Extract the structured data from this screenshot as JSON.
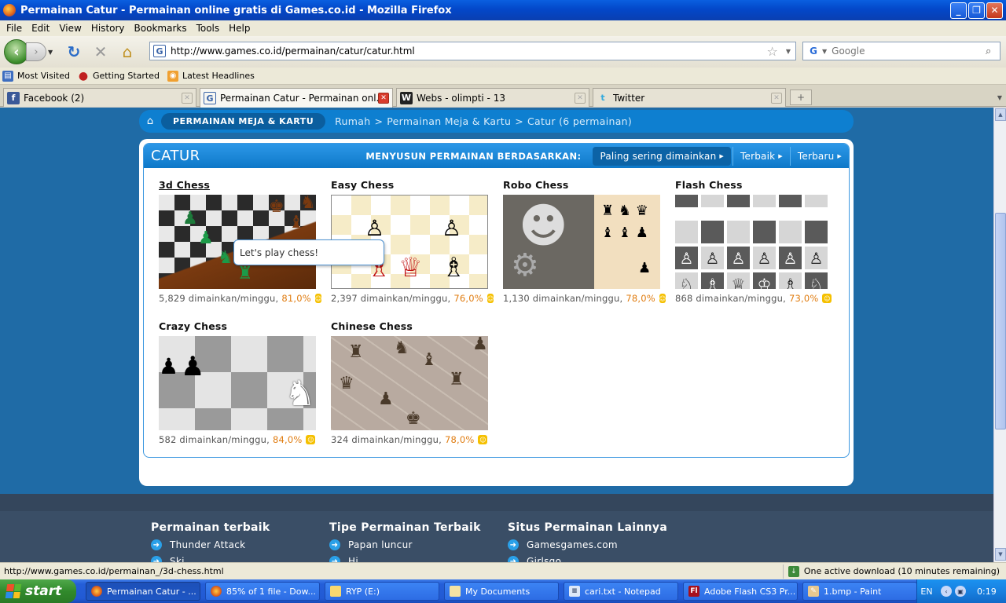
{
  "window": {
    "title": "Permainan Catur - Permainan online gratis di Games.co.id - Mozilla Firefox",
    "controls": {
      "minimize": "_",
      "maximize": "❐",
      "close": "✕"
    }
  },
  "menu": [
    "File",
    "Edit",
    "View",
    "History",
    "Bookmarks",
    "Tools",
    "Help"
  ],
  "nav": {
    "url": "http://www.games.co.id/permainan/catur/catur.html",
    "search_placeholder": "Google",
    "icons": [
      "back-arrow-icon",
      "forward-arrow-icon",
      "reload-icon",
      "stop-icon",
      "home-icon",
      "bookmark-star-icon",
      "search-magnifier-icon"
    ]
  },
  "bookmarks": [
    "Most Visited",
    "Getting Started",
    "Latest Headlines"
  ],
  "tabs": [
    {
      "label": "Facebook (2)",
      "icon": "f",
      "active": false
    },
    {
      "label": "Permainan Catur - Permainan onl...",
      "icon": "G",
      "active": true
    },
    {
      "label": "Webs - olimpti - 13",
      "icon": "W",
      "active": false
    },
    {
      "label": "Twitter",
      "icon": "t",
      "active": false
    }
  ],
  "page": {
    "breadcrumb_category": "PERMAINAN MEJA & KARTU",
    "breadcrumb": [
      "Rumah",
      ">",
      "Permainan Meja & Kartu",
      ">",
      "Catur (6 permainan)"
    ],
    "section_title": "CATUR",
    "sort_label": "MENYUSUN PERMAINAN BERDASARKAN:",
    "sort_options": [
      "Paling sering dimainkan",
      "Terbaik",
      "Terbaru"
    ],
    "tooltip": "Let's play chess!",
    "games": [
      {
        "title": "3d Chess",
        "plays": "5,829 dimainkan/minggu,",
        "rating": "81,0%"
      },
      {
        "title": "Easy Chess",
        "plays": "2,397 dimainkan/minggu,",
        "rating": "76,0%"
      },
      {
        "title": "Robo Chess",
        "plays": "1,130 dimainkan/minggu,",
        "rating": "78,0%"
      },
      {
        "title": "Flash Chess",
        "plays": "868 dimainkan/minggu,",
        "rating": "73,0%"
      },
      {
        "title": "Crazy Chess",
        "plays": "582 dimainkan/minggu,",
        "rating": "84,0%"
      },
      {
        "title": "Chinese Chess",
        "plays": "324 dimainkan/minggu,",
        "rating": "78,0%"
      }
    ],
    "footer": [
      {
        "title": "Permainan terbaik",
        "links": [
          "Thunder Attack",
          "Ski..."
        ]
      },
      {
        "title": "Tipe Permainan Terbaik",
        "links": [
          "Papan luncur",
          "Hi..."
        ]
      },
      {
        "title": "Situs Permainan Lainnya",
        "links": [
          "Gamesgames.com",
          "Girlsgo..."
        ]
      }
    ]
  },
  "status": {
    "url": "http://www.games.co.id/permainan_/3d-chess.html",
    "download": "One active download (10 minutes remaining)"
  },
  "taskbar": {
    "start": "start",
    "tasks": [
      "Permainan Catur - ...",
      "85% of 1 file - Dow...",
      "RYP (E:)",
      "My Documents",
      "cari.txt - Notepad",
      "Adobe Flash CS3 Pr...",
      "1.bmp - Paint"
    ],
    "lang": "EN",
    "clock": "0:19"
  },
  "colors": {
    "page_bg": "#1f6ba6",
    "accent_blue": "#0e7fd0",
    "rating_orange": "#e07c10",
    "footer_bg": "#3a4e66"
  }
}
